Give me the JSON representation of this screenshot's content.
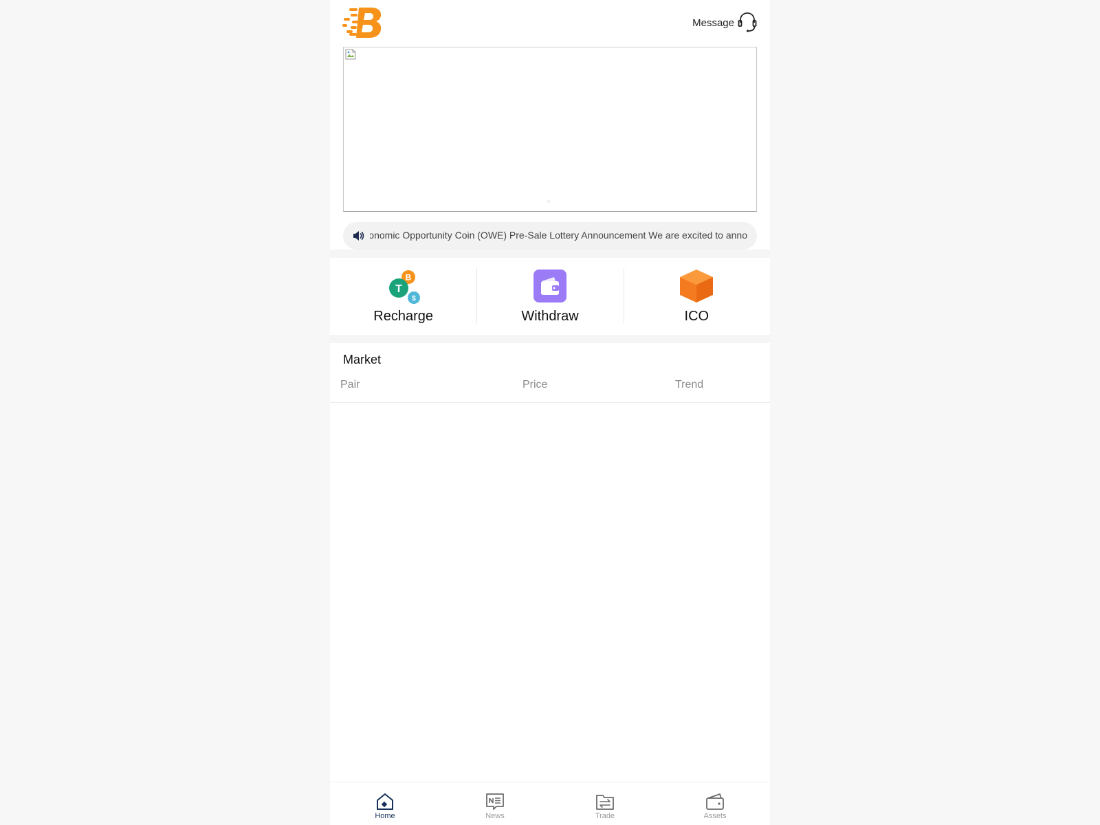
{
  "header": {
    "message_label": "Message"
  },
  "notice": {
    "text": "Global Economic Opportunity Coin (OWE) Pre-Sale Lottery Announcement We are excited to anno"
  },
  "actions": [
    {
      "label": "Recharge",
      "icon": "coins-icon"
    },
    {
      "label": "Withdraw",
      "icon": "wallet-icon"
    },
    {
      "label": "ICO",
      "icon": "cube-icon"
    }
  ],
  "market": {
    "title": "Market",
    "columns": [
      "Pair",
      "Price",
      "Trend"
    ]
  },
  "tabs": [
    {
      "label": "Home",
      "icon": "home-icon",
      "active": true
    },
    {
      "label": "News",
      "icon": "news-icon",
      "active": false
    },
    {
      "label": "Trade",
      "icon": "trade-icon",
      "active": false
    },
    {
      "label": "Assets",
      "icon": "assets-icon",
      "active": false
    }
  ],
  "colors": {
    "brand": "#f7931a",
    "withdraw": "#9b7cf6",
    "ico": "#f47b20",
    "tab_active": "#16305a",
    "tab_inactive": "#9b9b9b"
  }
}
